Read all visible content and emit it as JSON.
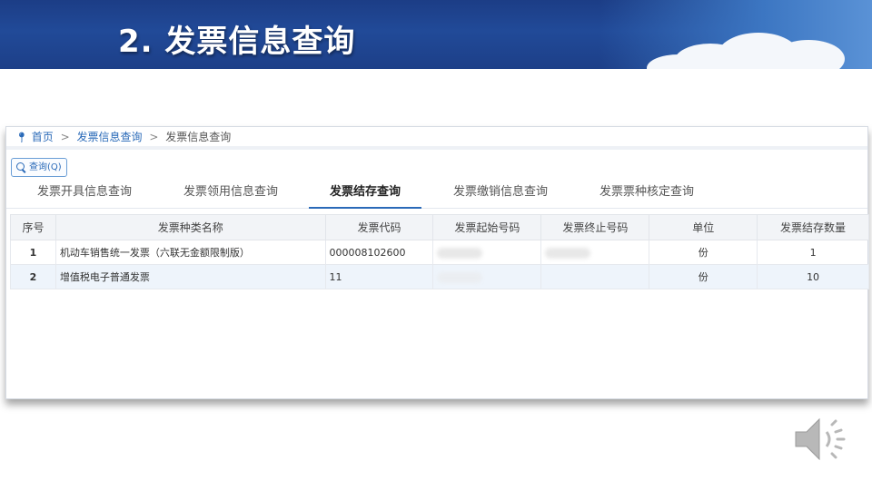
{
  "slide": {
    "title": "2. 发票信息查询"
  },
  "breadcrumb": {
    "home": "首页",
    "sep": ">",
    "level1": "发票信息查询",
    "current": "发票信息查询"
  },
  "toolbar": {
    "query_label": "查询(Q)"
  },
  "tabs": [
    {
      "label": "发票开具信息查询",
      "active": false
    },
    {
      "label": "发票领用信息查询",
      "active": false
    },
    {
      "label": "发票结存查询",
      "active": true
    },
    {
      "label": "发票缴销信息查询",
      "active": false
    },
    {
      "label": "发票票种核定查询",
      "active": false
    }
  ],
  "table": {
    "columns": [
      "序号",
      "发票种类名称",
      "发票代码",
      "发票起始号码",
      "发票终止号码",
      "单位",
      "发票结存数量"
    ],
    "rows": [
      {
        "seq": "1",
        "name": "机动车销售统一发票（六联无金额限制版）",
        "code": "000008102600",
        "start": "",
        "end": "",
        "unit": "份",
        "qty": "1"
      },
      {
        "seq": "2",
        "name": "增值税电子普通发票",
        "code": "11",
        "start": "",
        "end": "",
        "unit": "份",
        "qty": "10"
      }
    ]
  },
  "icons": {
    "breadcrumb": "location-pin-icon",
    "query": "search-icon",
    "audio": "speaker-icon"
  },
  "colors": {
    "banner": "#1d3f88",
    "accent": "#2a6ab8",
    "row_alt": "#eef4fb"
  }
}
